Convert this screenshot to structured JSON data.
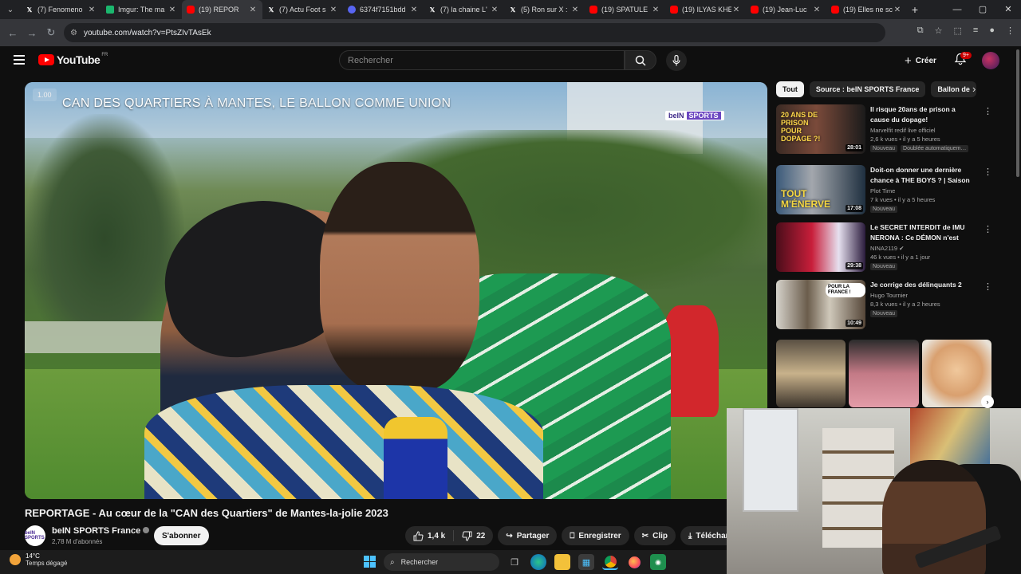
{
  "browser": {
    "tabs": [
      {
        "label": "(7) Fenomeno",
        "icon": "x-logo",
        "active": false
      },
      {
        "label": "Imgur: The ma",
        "icon": "imgur",
        "active": false
      },
      {
        "label": "(19) REPOR",
        "icon": "youtube",
        "active": true
      },
      {
        "label": "(7) Actu Foot s",
        "icon": "x-logo",
        "active": false
      },
      {
        "label": "6374f7151bdd",
        "icon": "discord",
        "active": false
      },
      {
        "label": "(7) la chaine L'",
        "icon": "x-logo",
        "active": false
      },
      {
        "label": "(5) Ron sur X :",
        "icon": "x-logo",
        "active": false
      },
      {
        "label": "(19) SPATULE",
        "icon": "youtube",
        "active": false
      },
      {
        "label": "(19) ILYAS KHE",
        "icon": "youtube",
        "active": false
      },
      {
        "label": "(19) Jean-Luc",
        "icon": "youtube",
        "active": false
      },
      {
        "label": "(19) Elles ne sc",
        "icon": "youtube",
        "active": false
      }
    ],
    "url": "youtube.com/watch?v=PtsZIvTAsEk"
  },
  "youtube": {
    "logo_text": "YouTube",
    "logo_country": "FR",
    "search_placeholder": "Rechercher",
    "create_label": "Créer",
    "notif_count": "9+"
  },
  "player": {
    "speed": "1.00",
    "caption_bold": "CAN DES QUARTIERS",
    "caption_light": "À MANTES, LE BALLON COMME UNION",
    "broadcaster_a": "beIN",
    "broadcaster_b": "SPORTS"
  },
  "video": {
    "title": "REPORTAGE - Au cœur de la \"CAN des Quartiers\" de Mantes-la-jolie 2023",
    "channel": "beIN SPORTS France",
    "channel_avatar": "beIN SPORTS",
    "subscribers": "2,78 M d'abonnés",
    "subscribe_label": "S'abonner",
    "likes": "1,4 k",
    "dislikes": "22",
    "share_label": "Partager",
    "save_label": "Enregistrer",
    "clip_label": "Clip",
    "download_label": "Téléchar"
  },
  "chips": [
    "Tout",
    "Source : beIN SPORTS France",
    "Ballon de"
  ],
  "recommendations": [
    {
      "title": "Il risque 20ans de prison a cause du dopage!",
      "channel": "Marvelfit redif live officiel",
      "meta": "2,6 k vues • il y a 5 heures",
      "duration": "28:01",
      "badges": [
        "Nouveau",
        "Doublée automatiquem…"
      ],
      "thumb_text": "20 ANS DE PRISON POUR DOPAGE ?!"
    },
    {
      "title": "Doit-on donner une dernière chance à THE BOYS ? | Saison …",
      "channel": "Plot Time",
      "meta": "7 k vues • il y a 5 heures",
      "duration": "17:08",
      "badges": [
        "Nouveau"
      ],
      "thumb_text": "TOUT M'ÉNERVE"
    },
    {
      "title": "Le SECRET INTERDIT de IMU NERONA : Ce DÉMON n'est PA…",
      "channel": "NINA2119",
      "meta": "46 k vues • il y a 1 jour",
      "duration": "29:38",
      "badges": [
        "Nouveau"
      ],
      "thumb_text": ""
    },
    {
      "title": "Je corrige des délinquants 2",
      "channel": "Hugo Tournier",
      "meta": "8,3 k vues • il y a 2 heures",
      "duration": "10:49",
      "badges": [
        "Nouveau"
      ],
      "thumb_text": "POUR LA FRANCE !"
    }
  ],
  "taskbar": {
    "temperature": "14°C",
    "weather": "Temps dégagé",
    "search_label": "Rechercher"
  }
}
